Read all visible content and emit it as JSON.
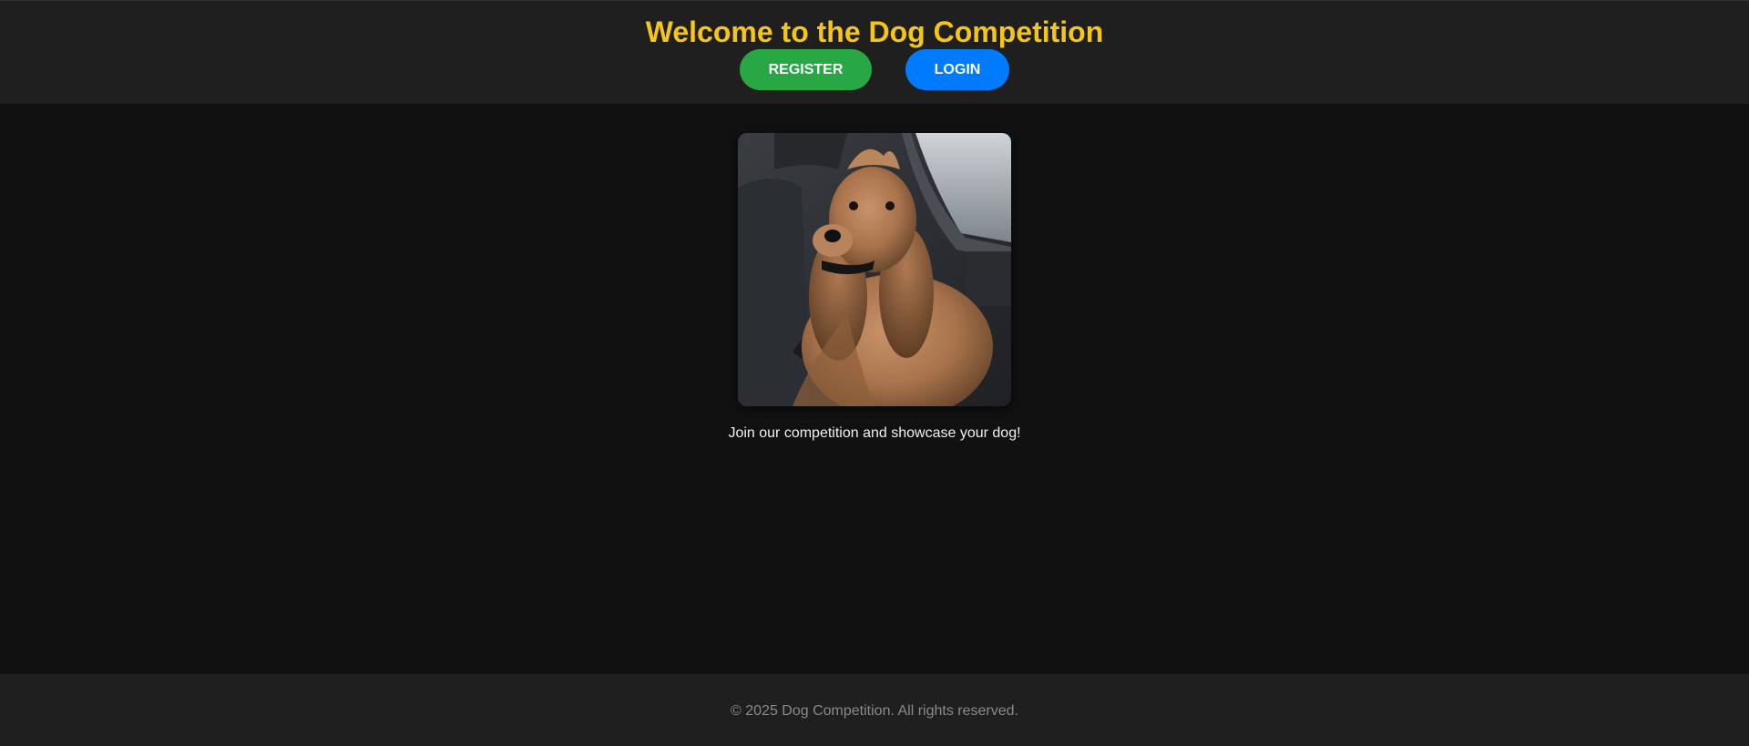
{
  "header": {
    "title": "Welcome to the Dog Competition",
    "register_label": "REGISTER",
    "login_label": "LOGIN"
  },
  "main": {
    "hero_image_subject": "dog-photo",
    "tagline": "Join our competition and showcase your dog!"
  },
  "footer": {
    "copyright": "© 2025 Dog Competition. All rights reserved."
  },
  "colors": {
    "page_background": "#111111",
    "header_background": "#1f1f1f",
    "title": "#f5c518",
    "register_button": "#28a745",
    "login_button": "#007bff",
    "footer_text": "#8a8a8a"
  }
}
